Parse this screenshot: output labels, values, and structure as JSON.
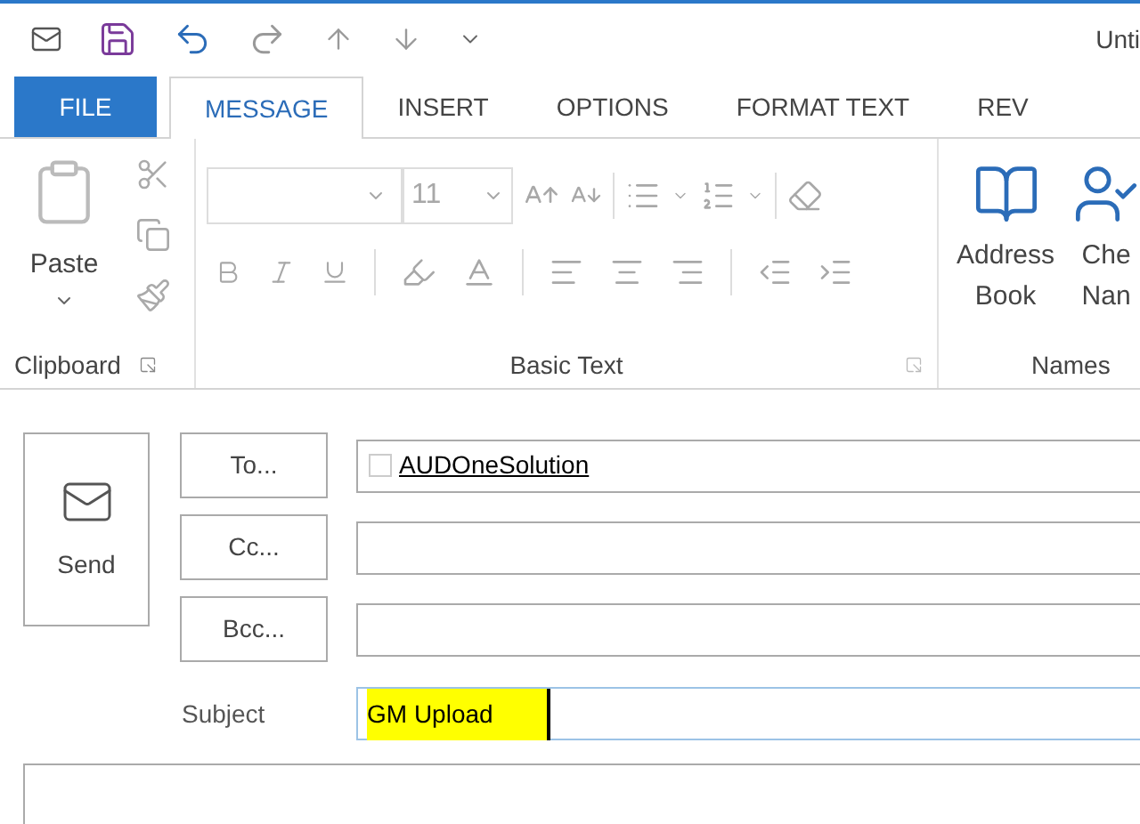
{
  "window": {
    "title": "Unti"
  },
  "tabs": [
    {
      "label": "FILE",
      "kind": "file",
      "selected": false
    },
    {
      "label": "MESSAGE",
      "kind": "tab",
      "selected": true
    },
    {
      "label": "INSERT",
      "kind": "tab",
      "selected": false
    },
    {
      "label": "OPTIONS",
      "kind": "tab",
      "selected": false
    },
    {
      "label": "FORMAT TEXT",
      "kind": "tab",
      "selected": false
    },
    {
      "label": "REV",
      "kind": "tab",
      "selected": false
    }
  ],
  "ribbon": {
    "clipboard": {
      "label": "Clipboard",
      "paste": "Paste"
    },
    "basic_text": {
      "label": "Basic Text",
      "font_size": "11",
      "disabled": true
    },
    "names": {
      "label": "Names",
      "buttons": [
        {
          "lines": [
            "Address",
            "Book"
          ],
          "kind": "book"
        },
        {
          "lines": [
            "Che",
            "Nan"
          ],
          "kind": "check"
        }
      ]
    }
  },
  "send": {
    "label": "Send"
  },
  "recipients": [
    {
      "button": "To...",
      "recipient": "AUDOneSolution"
    },
    {
      "button": "Cc..."
    },
    {
      "button": "Bcc..."
    }
  ],
  "subject": {
    "label": "Subject",
    "value": "GM Upload",
    "highlighted": true
  }
}
